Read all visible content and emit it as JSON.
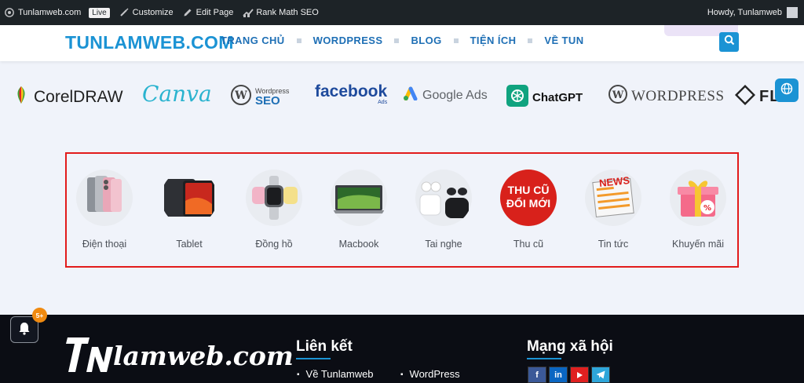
{
  "admin_bar": {
    "site_name": "Tunlamweb.com",
    "live_badge": "Live",
    "customize": "Customize",
    "edit_page": "Edit Page",
    "rank_math": "Rank Math SEO",
    "howdy": "Howdy, Tunlamweb"
  },
  "header": {
    "logo": "TUNLAMWEB.COM",
    "nav": [
      "TRANG CHỦ",
      "WORDPRESS",
      "BLOG",
      "TIỆN ÍCH",
      "VỀ TUN"
    ]
  },
  "brands": {
    "coreldraw": "CorelDRAW",
    "canva": "Canva",
    "wp_seo_top": "Wordpress",
    "wp_seo_bottom": "SEO",
    "facebook": "facebook",
    "facebook_sub": "Ads",
    "google_ads": "Google Ads",
    "chatgpt": "ChatGPT",
    "wordpress": "WORDPRESS",
    "flash": "FL"
  },
  "categories": [
    {
      "label": "Điện thoại",
      "icon": "phone-icon"
    },
    {
      "label": "Tablet",
      "icon": "tablet-icon"
    },
    {
      "label": "Đồng hồ",
      "icon": "watch-icon"
    },
    {
      "label": "Macbook",
      "icon": "laptop-icon"
    },
    {
      "label": "Tai nghe",
      "icon": "earbuds-icon"
    },
    {
      "label": "Thu cũ",
      "icon": "trade-in-icon",
      "badge_top": "THU CŨ",
      "badge_bottom": "ĐỔI MỚI"
    },
    {
      "label": "Tin tức",
      "icon": "news-icon",
      "badge": "NEWS"
    },
    {
      "label": "Khuyến mãi",
      "icon": "gift-icon"
    }
  ],
  "footer": {
    "notification_count": "5+",
    "logo_script": "lamweb.com",
    "links_heading": "Liên kết",
    "social_heading": "Mạng xã hội",
    "links": [
      "Về Tunlamweb",
      "WordPress"
    ],
    "social": [
      "facebook-icon",
      "linkedin-icon",
      "youtube-icon",
      "telegram-icon"
    ]
  },
  "colors": {
    "brand_blue": "#1b93d4",
    "nav_blue": "#1e6fb5",
    "highlight_red": "#e21b1b",
    "footer_bg": "#0b0d14"
  }
}
